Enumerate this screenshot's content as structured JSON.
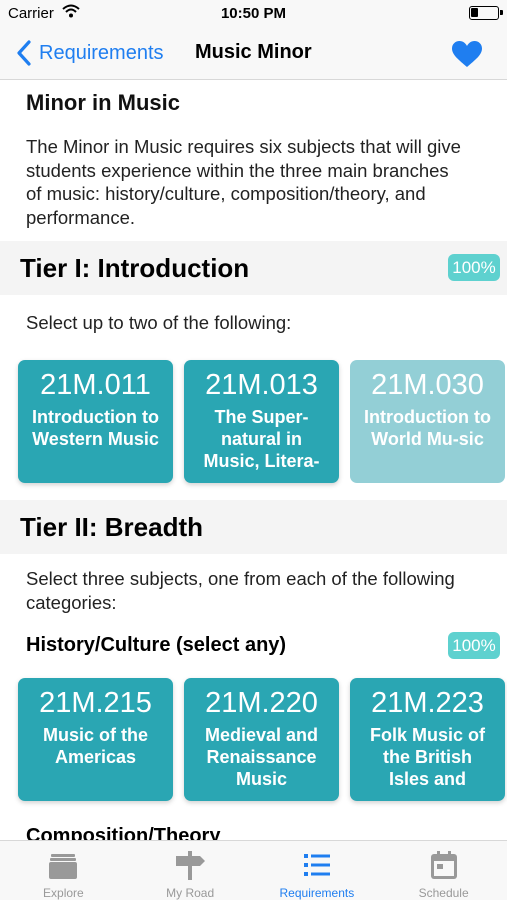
{
  "status_bar": {
    "carrier": "Carrier",
    "time": "10:50 PM"
  },
  "nav": {
    "back_label": "Requirements",
    "title": "Music Minor",
    "favorite_icon": "heart-icon",
    "accent_color": "#1f7ef0"
  },
  "minor": {
    "title": "Minor in Music",
    "description": "The Minor in Music requires six subjects that will give students experience within the three main branches of music: history/culture, composition/theory, and performance."
  },
  "tier1": {
    "title": "Tier I: Introduction",
    "progress": "100%",
    "instruction": "Select up to two of the following:",
    "courses": [
      {
        "number": "21M.011",
        "name": "Introduction to Western Music",
        "completed": true
      },
      {
        "number": "21M.013",
        "name": "The Super-natural in Music, Litera-",
        "completed": true
      },
      {
        "number": "21M.030",
        "name": "Introduction to World Mu-sic",
        "completed": false
      }
    ]
  },
  "tier2": {
    "title": "Tier II: Breadth",
    "instruction": "Select three subjects, one from each of the following categories:",
    "history": {
      "title": "History/Culture (select any)",
      "progress": "100%",
      "courses": [
        {
          "number": "21M.215",
          "name": "Music of the Americas"
        },
        {
          "number": "21M.220",
          "name": "Medieval and Renaissance Music"
        },
        {
          "number": "21M.223",
          "name": "Folk Music of the British Isles and"
        }
      ]
    },
    "next_section": "Composition/Theory"
  },
  "colors": {
    "card": "#2aa6b3",
    "card_faded": "#93cfd6",
    "badge": "#5ed1cf"
  },
  "tabs": [
    {
      "label": "Explore",
      "icon": "folder-icon",
      "active": false
    },
    {
      "label": "My Road",
      "icon": "signpost-icon",
      "active": false
    },
    {
      "label": "Requirements",
      "icon": "list-icon",
      "active": true
    },
    {
      "label": "Schedule",
      "icon": "calendar-icon",
      "active": false
    }
  ]
}
